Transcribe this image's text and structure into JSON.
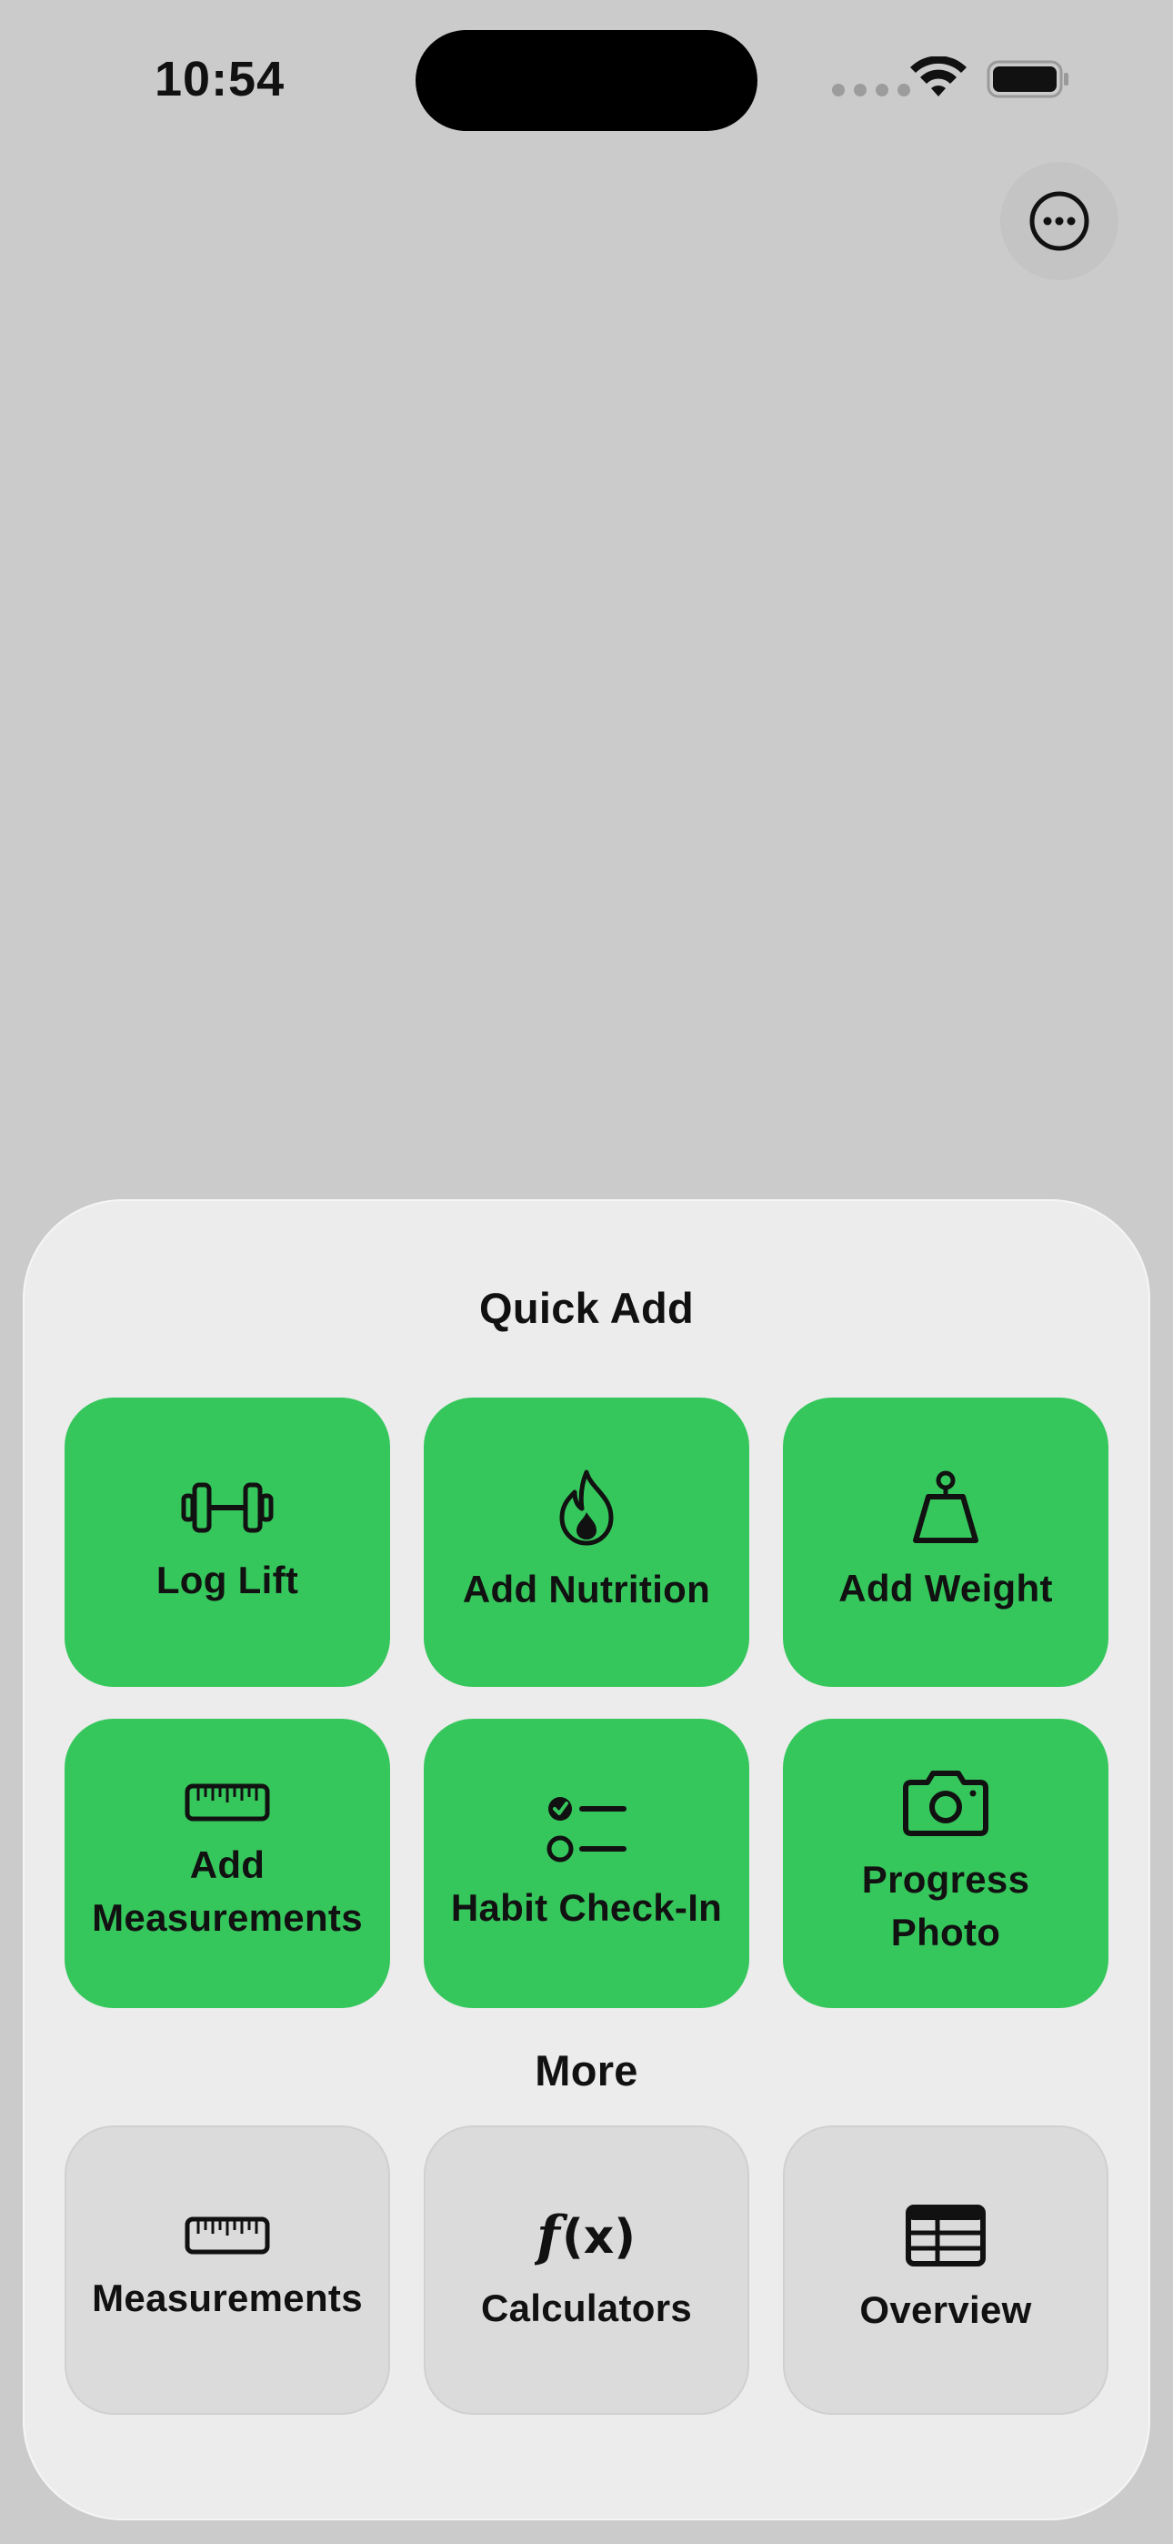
{
  "status_bar": {
    "time": "10:54"
  },
  "header": {
    "more_icon": "ellipsis-circle-icon"
  },
  "sheet": {
    "quick_add_title": "Quick Add",
    "more_title": "More",
    "quick_add": [
      {
        "label": "Log Lift",
        "icon": "dumbbell-icon"
      },
      {
        "label": "Add Nutrition",
        "icon": "flame-icon"
      },
      {
        "label": "Add Weight",
        "icon": "scale-weight-icon"
      },
      {
        "label": "Add\nMeasurements",
        "icon": "ruler-icon"
      },
      {
        "label": "Habit Check-In",
        "icon": "checklist-icon"
      },
      {
        "label": "Progress\nPhoto",
        "icon": "camera-icon"
      }
    ],
    "more": [
      {
        "label": "Measurements",
        "icon": "ruler-icon"
      },
      {
        "label": "Calculators",
        "icon": "function-icon"
      },
      {
        "label": "Overview",
        "icon": "table-icon"
      }
    ]
  },
  "colors": {
    "accent_green": "#36c75c",
    "sheet_bg": "#ececec",
    "backdrop": "#cbcbcb",
    "secondary_tile": "#dbdbdc"
  }
}
